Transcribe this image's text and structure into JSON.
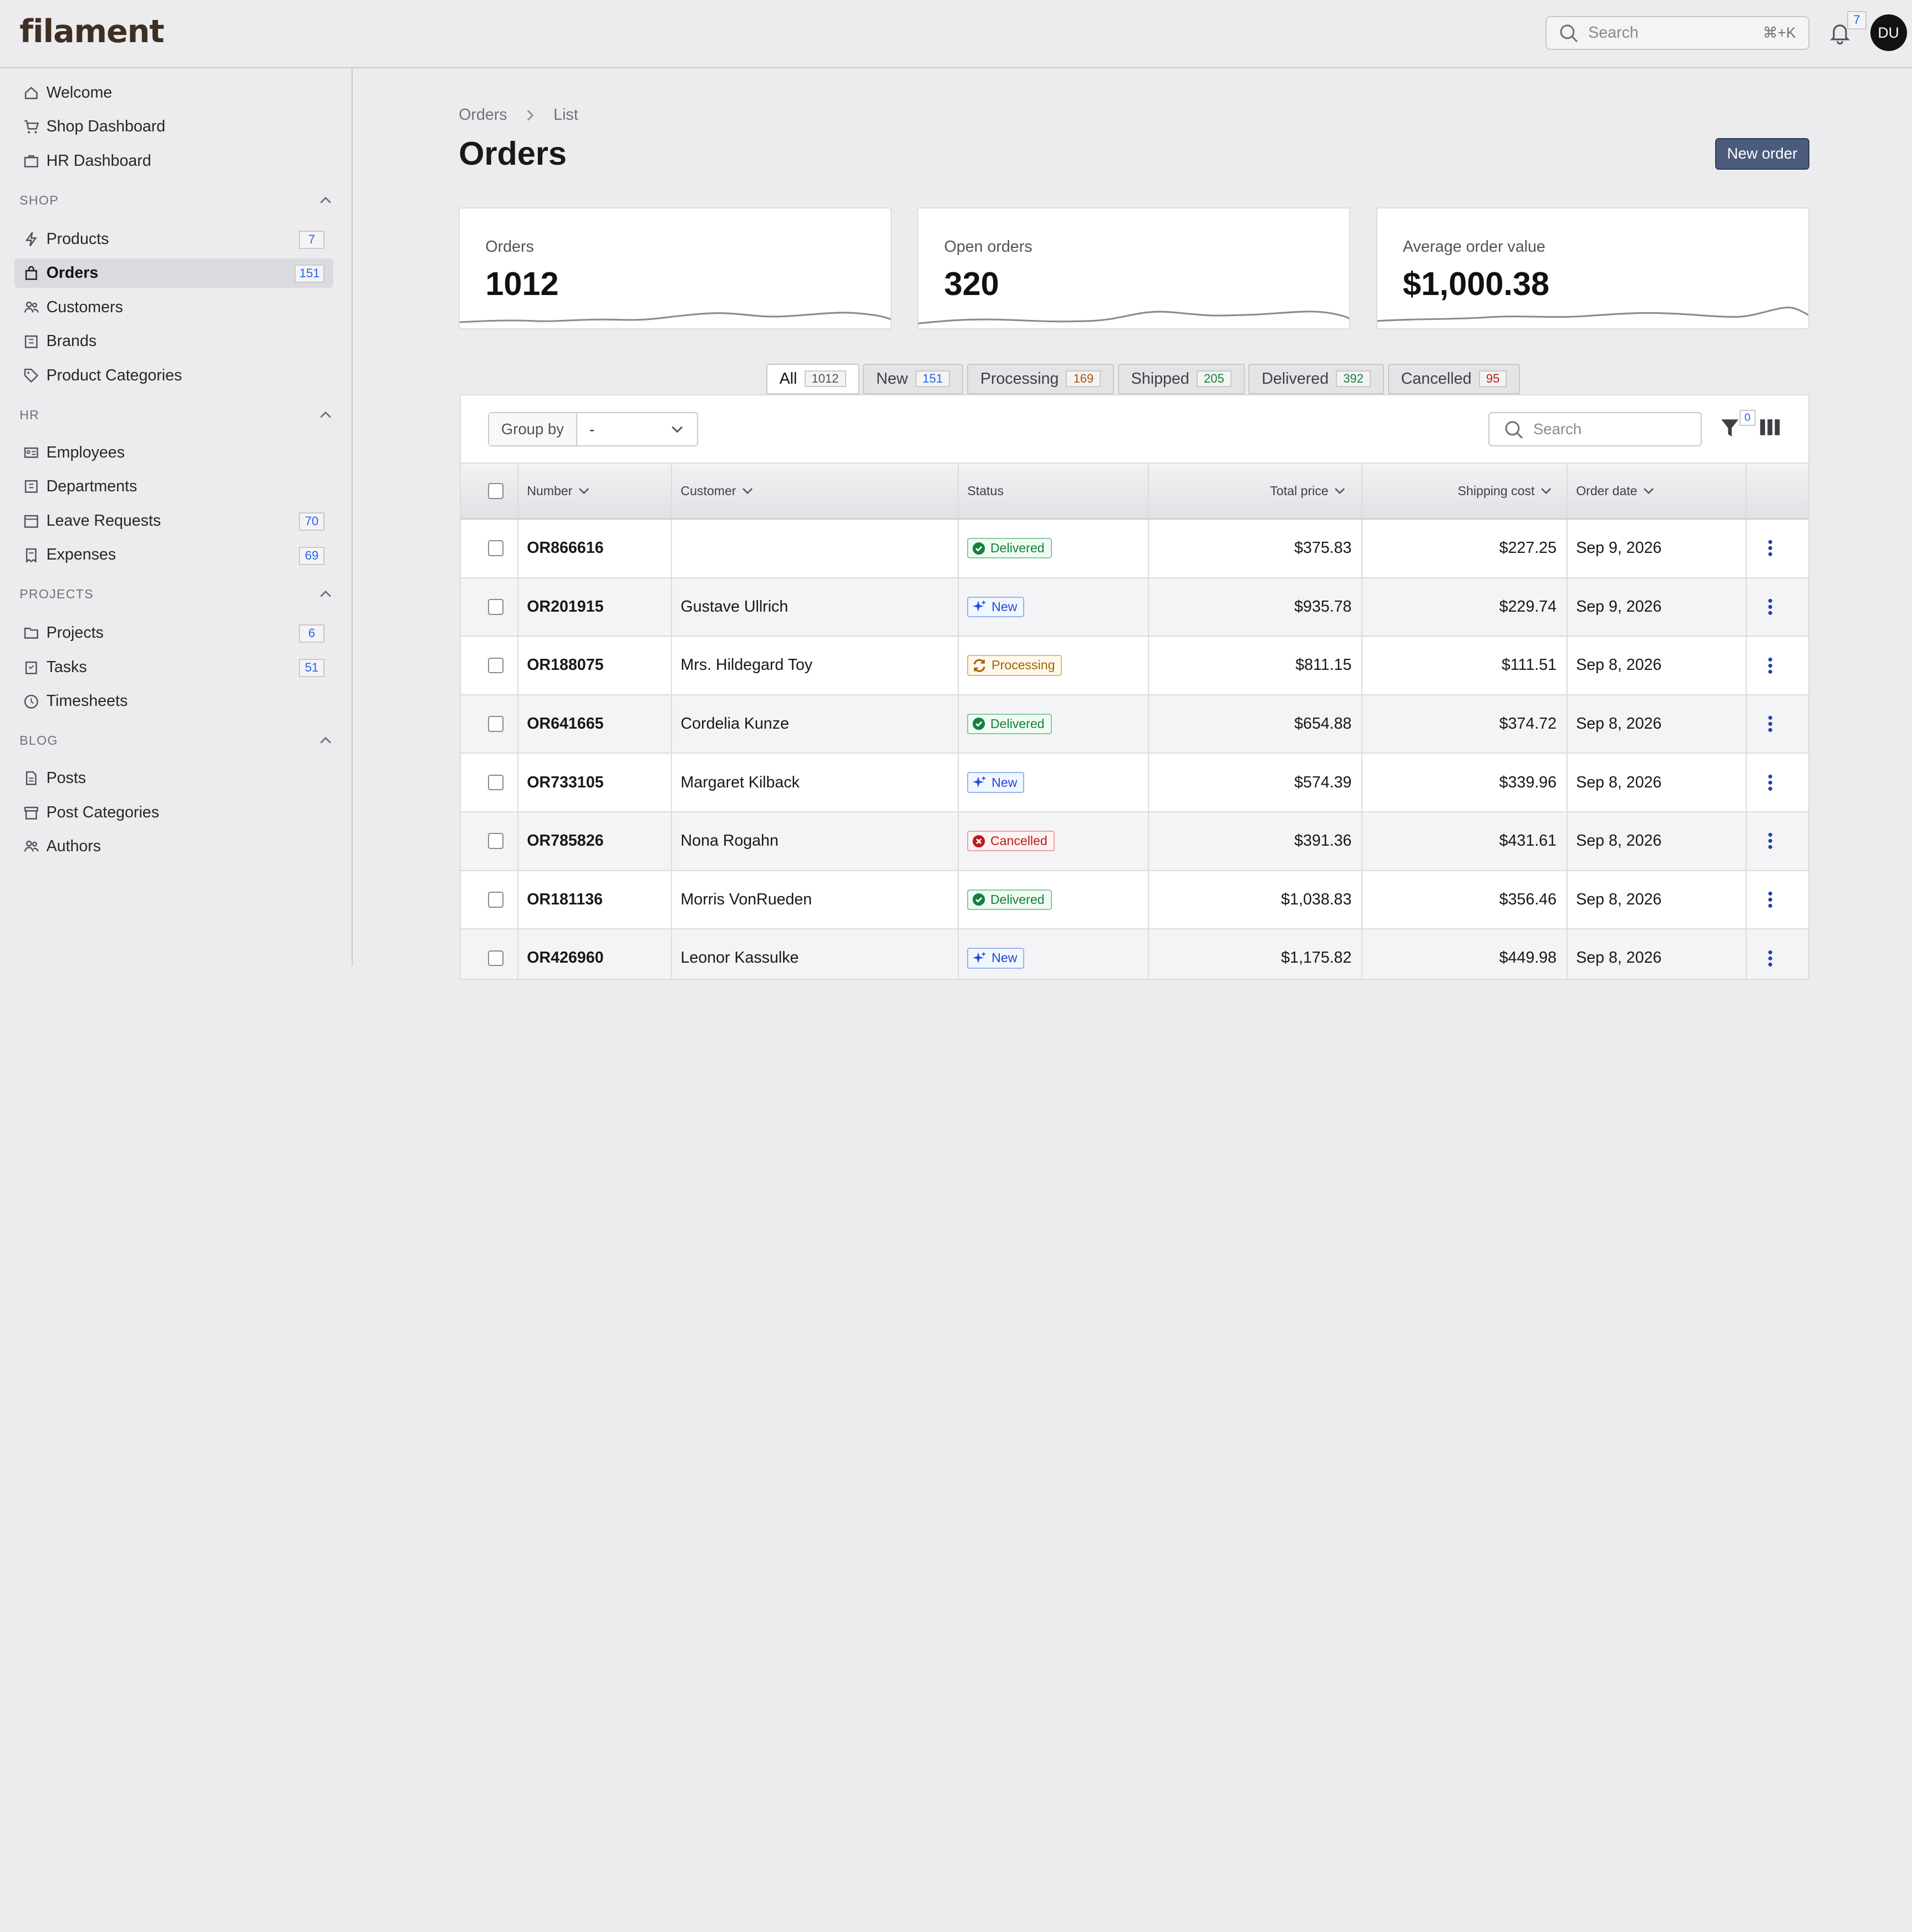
{
  "app": {
    "logo": "filament"
  },
  "topbar": {
    "search_placeholder": "Search",
    "search_shortcut": "⌘+K",
    "notification_count": "7",
    "avatar_initials": "DU"
  },
  "sidebar": {
    "top_items": [
      {
        "label": "Welcome",
        "icon": "home-icon"
      },
      {
        "label": "Shop Dashboard",
        "icon": "cart-icon"
      },
      {
        "label": "HR Dashboard",
        "icon": "briefcase-icon"
      }
    ],
    "groups": [
      {
        "title": "SHOP",
        "items": [
          {
            "label": "Products",
            "badge": "7",
            "icon": "bolt-icon"
          },
          {
            "label": "Orders",
            "badge": "151",
            "icon": "shopping-bag-icon",
            "active": true
          },
          {
            "label": "Customers",
            "badge": "",
            "icon": "users-icon"
          },
          {
            "label": "Brands",
            "badge": "",
            "icon": "building-icon"
          },
          {
            "label": "Product Categories",
            "badge": "",
            "icon": "tag-icon"
          }
        ]
      },
      {
        "title": "HR",
        "items": [
          {
            "label": "Employees",
            "badge": "",
            "icon": "id-card-icon"
          },
          {
            "label": "Departments",
            "badge": "",
            "icon": "building-icon"
          },
          {
            "label": "Leave Requests",
            "badge": "70",
            "icon": "calendar-icon"
          },
          {
            "label": "Expenses",
            "badge": "69",
            "icon": "receipt-icon"
          }
        ]
      },
      {
        "title": "PROJECTS",
        "items": [
          {
            "label": "Projects",
            "badge": "6",
            "icon": "folder-icon"
          },
          {
            "label": "Tasks",
            "badge": "51",
            "icon": "clipboard-icon"
          },
          {
            "label": "Timesheets",
            "badge": "",
            "icon": "clock-icon"
          }
        ]
      },
      {
        "title": "BLOG",
        "items": [
          {
            "label": "Posts",
            "badge": "",
            "icon": "document-icon"
          },
          {
            "label": "Post Categories",
            "badge": "",
            "icon": "archive-icon"
          },
          {
            "label": "Authors",
            "badge": "",
            "icon": "users-icon"
          }
        ]
      }
    ]
  },
  "breadcrumb": {
    "parent": "Orders",
    "current": "List"
  },
  "page": {
    "title": "Orders",
    "new_button": "New order"
  },
  "stats": [
    {
      "label": "Orders",
      "value": "1012"
    },
    {
      "label": "Open orders",
      "value": "320"
    },
    {
      "label": "Average order value",
      "value": "$1,000.38"
    }
  ],
  "tabs": [
    {
      "label": "All",
      "count": "1012",
      "color": "#52525b",
      "active": true
    },
    {
      "label": "New",
      "count": "151",
      "color": "#2563eb"
    },
    {
      "label": "Processing",
      "count": "169",
      "color": "#b45309"
    },
    {
      "label": "Shipped",
      "count": "205",
      "color": "#15803d"
    },
    {
      "label": "Delivered",
      "count": "392",
      "color": "#15803d"
    },
    {
      "label": "Cancelled",
      "count": "95",
      "color": "#b91c1c"
    }
  ],
  "toolbar": {
    "group_by_label": "Group by",
    "group_by_value": "-",
    "search_placeholder": "Search",
    "filter_count": "0"
  },
  "table": {
    "columns": [
      "Number",
      "Customer",
      "Status",
      "Total price",
      "Shipping cost",
      "Order date"
    ],
    "rows": [
      {
        "number": "OR866616",
        "customer": "",
        "status": "Delivered",
        "total": "$375.83",
        "shipping": "$227.25",
        "date": "Sep 9, 2026"
      },
      {
        "number": "OR201915",
        "customer": "Gustave Ullrich",
        "status": "New",
        "total": "$935.78",
        "shipping": "$229.74",
        "date": "Sep 9, 2026"
      },
      {
        "number": "OR188075",
        "customer": "Mrs. Hildegard Toy",
        "status": "Processing",
        "total": "$811.15",
        "shipping": "$111.51",
        "date": "Sep 8, 2026"
      },
      {
        "number": "OR641665",
        "customer": "Cordelia Kunze",
        "status": "Delivered",
        "total": "$654.88",
        "shipping": "$374.72",
        "date": "Sep 8, 2026"
      },
      {
        "number": "OR733105",
        "customer": "Margaret Kilback",
        "status": "New",
        "total": "$574.39",
        "shipping": "$339.96",
        "date": "Sep 8, 2026"
      },
      {
        "number": "OR785826",
        "customer": "Nona Rogahn",
        "status": "Cancelled",
        "total": "$391.36",
        "shipping": "$431.61",
        "date": "Sep 8, 2026"
      },
      {
        "number": "OR181136",
        "customer": "Morris VonRueden",
        "status": "Delivered",
        "total": "$1,038.83",
        "shipping": "$356.46",
        "date": "Sep 8, 2026"
      },
      {
        "number": "OR426960",
        "customer": "Leonor Kassulke",
        "status": "New",
        "total": "$1,175.82",
        "shipping": "$449.98",
        "date": "Sep 8, 2026"
      }
    ]
  }
}
